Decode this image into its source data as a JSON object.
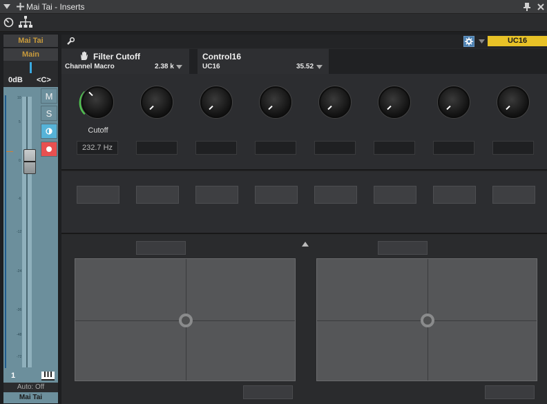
{
  "window": {
    "title": "Mai Tai - Inserts"
  },
  "channel": {
    "name": "Mai Tai",
    "output": "Main",
    "volume": "0dB",
    "pan": "<C>",
    "mute": "M",
    "solo": "S",
    "scale": [
      "10",
      "5",
      "0",
      "-6",
      "-12",
      "-24",
      "-36",
      "-48",
      "-72"
    ],
    "number": "1",
    "automation": "Auto: Off",
    "footer_name": "Mai Tai"
  },
  "control": {
    "device": "UC16"
  },
  "params": [
    {
      "name": "Filter Cutoff",
      "sub": "Channel Macro",
      "value": "2.38 k"
    },
    {
      "name": "Control16",
      "sub": "UC16",
      "value": "35.52"
    }
  ],
  "knobs": [
    {
      "label": "Cutoff",
      "value": "232.7 Hz"
    },
    {
      "label": "",
      "value": ""
    },
    {
      "label": "",
      "value": ""
    },
    {
      "label": "",
      "value": ""
    },
    {
      "label": "",
      "value": ""
    },
    {
      "label": "",
      "value": ""
    },
    {
      "label": "",
      "value": ""
    },
    {
      "label": "",
      "value": ""
    }
  ],
  "colors": {
    "accent": "#e8c227",
    "strip": "#6c8f9c",
    "record": "#e85050",
    "monitor": "#56b3d8",
    "knob_ring": "#4fc24f"
  }
}
